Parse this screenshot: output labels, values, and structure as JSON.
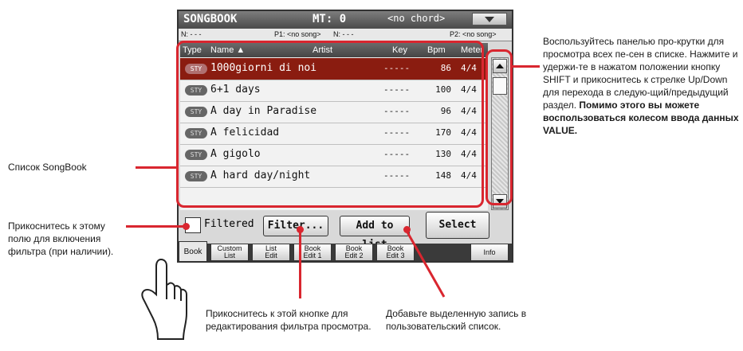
{
  "screen": {
    "title": "SONGBOOK",
    "mt_label": "MT: 0",
    "chord": "<no chord>",
    "info": {
      "n_left": "N: - - -",
      "p1": "P1: <no song>",
      "n_mid": "N: - - -",
      "p2": "P2: <no song>"
    },
    "columns": [
      "Type",
      "Name ▲",
      "Artist",
      "Key",
      "Bpm",
      "Meter"
    ],
    "rows": [
      {
        "type": "STY",
        "name": "1000giorni di noi",
        "key": "-----",
        "bpm": "86",
        "meter": "4/4",
        "selected": true
      },
      {
        "type": "STY",
        "name": "6+1 days",
        "key": "-----",
        "bpm": "100",
        "meter": "4/4",
        "selected": false
      },
      {
        "type": "STY",
        "name": "A day in Paradise",
        "key": "-----",
        "bpm": "96",
        "meter": "4/4",
        "selected": false
      },
      {
        "type": "STY",
        "name": "A felicidad",
        "key": "-----",
        "bpm": "170",
        "meter": "4/4",
        "selected": false
      },
      {
        "type": "STY",
        "name": "A gigolo",
        "key": "-----",
        "bpm": "130",
        "meter": "4/4",
        "selected": false
      },
      {
        "type": "STY",
        "name": "A hard day/night",
        "key": "-----",
        "bpm": "148",
        "meter": "4/4",
        "selected": false
      }
    ],
    "filtered_label": "Filtered",
    "filter_button": "Filter...",
    "add_button": "Add to list",
    "select_button": "Select",
    "tabs": [
      {
        "l1": "Book",
        "l2": ""
      },
      {
        "l1": "Custom",
        "l2": "List"
      },
      {
        "l1": "List",
        "l2": "Edit"
      },
      {
        "l1": "Book",
        "l2": "Edit 1"
      },
      {
        "l1": "Book",
        "l2": "Edit 2"
      },
      {
        "l1": "Book",
        "l2": "Edit 3"
      },
      {
        "l1": "Info",
        "l2": ""
      }
    ]
  },
  "callouts": {
    "scroll_note_plain": "Воспользуйтесь панелью про-крутки для просмотра всех пе-сен в списке. Нажмите и удержи-те в нажатом положении кнопку SHIFT и прикоснитесь к стрелке Up/Down для перехода в следую-щий/предыдущий раздел.",
    "scroll_note_bold": "Помимо этого вы можете воспользоваться колесом ввода данных VALUE.",
    "songbook_list": "Список SongBook",
    "filtered_note": "Прикоснитесь к этому полю для включения фильтра (при наличии).",
    "filter_note": "Прикоснитесь к этой кнопке для редактирования фильтра просмотра.",
    "add_note": "Добавьте выделенную запись в пользовательский список."
  },
  "colors": {
    "accent_red": "#d9262f",
    "selected_row": "#8a1c10"
  }
}
